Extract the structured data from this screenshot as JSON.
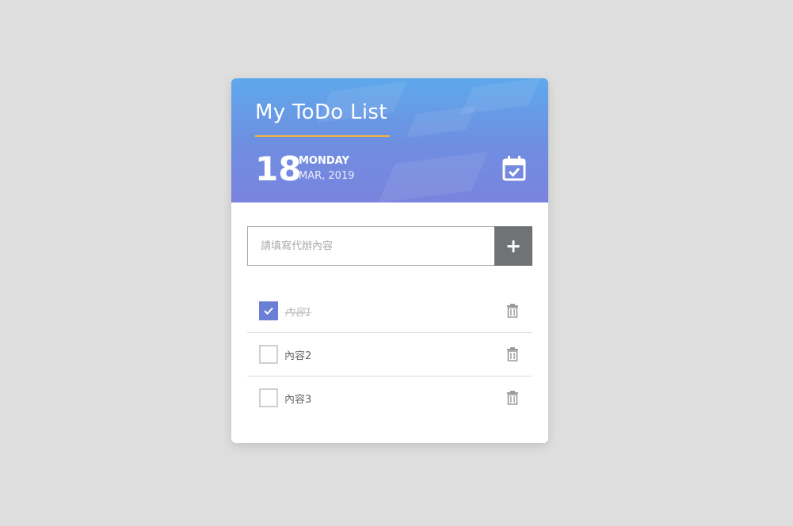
{
  "header": {
    "title": "My ToDo List",
    "day": "18",
    "weekday": "MONDAY",
    "month_year": "MAR, 2019"
  },
  "add_form": {
    "placeholder": "請填寫代辦內容",
    "value": "",
    "add_label": "+"
  },
  "todos": [
    {
      "text": "內容1",
      "done": true
    },
    {
      "text": "內容2",
      "done": false
    },
    {
      "text": "內容3",
      "done": false
    }
  ],
  "icons": {
    "calendar": "calendar-check-icon",
    "check": "check-icon",
    "delete": "trash-icon"
  },
  "colors": {
    "background": "#dedede",
    "header_gradient_top": "#5ea8ec",
    "header_gradient_bottom": "#7a83de",
    "accent_underline": "#f0b43a",
    "checkbox_checked": "#6b7fd7",
    "add_button": "#707376"
  }
}
